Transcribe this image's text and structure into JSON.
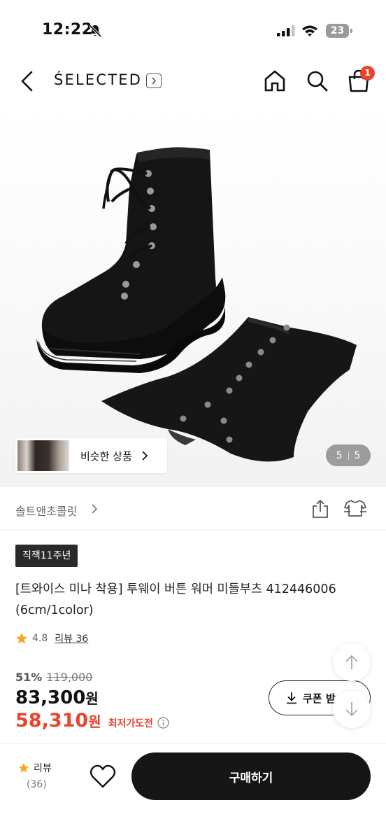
{
  "status_bar": {
    "time": "12:22",
    "battery": "23"
  },
  "header": {
    "brand": "ŚELECTED",
    "cart_count": "1"
  },
  "gallery": {
    "similar_label": "비슷한 상품",
    "page_current": "5",
    "page_total": "5"
  },
  "store": {
    "name": "솔트앤초콜릿"
  },
  "product": {
    "tag": "직잭11주년",
    "title": "[트와이스 미나 착용] 투웨이 버튼 워머 미들부츠 412446006 (6cm/1color)",
    "rating": "4.8",
    "review_label": "리뷰 36",
    "discount_pct": "51%",
    "original_price": "119,000",
    "price": "83,300",
    "price_unit": "원",
    "lowest_price": "58,310",
    "lowest_unit": "원",
    "lowest_label": "최저가도전",
    "coupon_label": "쿠폰 받"
  },
  "bottom_bar": {
    "review_label": "리뷰",
    "review_count": "(36)",
    "buy_label": "구매하기"
  },
  "colors": {
    "accent_red": "#e8442e",
    "star": "#f5a623",
    "dark": "#161616"
  }
}
